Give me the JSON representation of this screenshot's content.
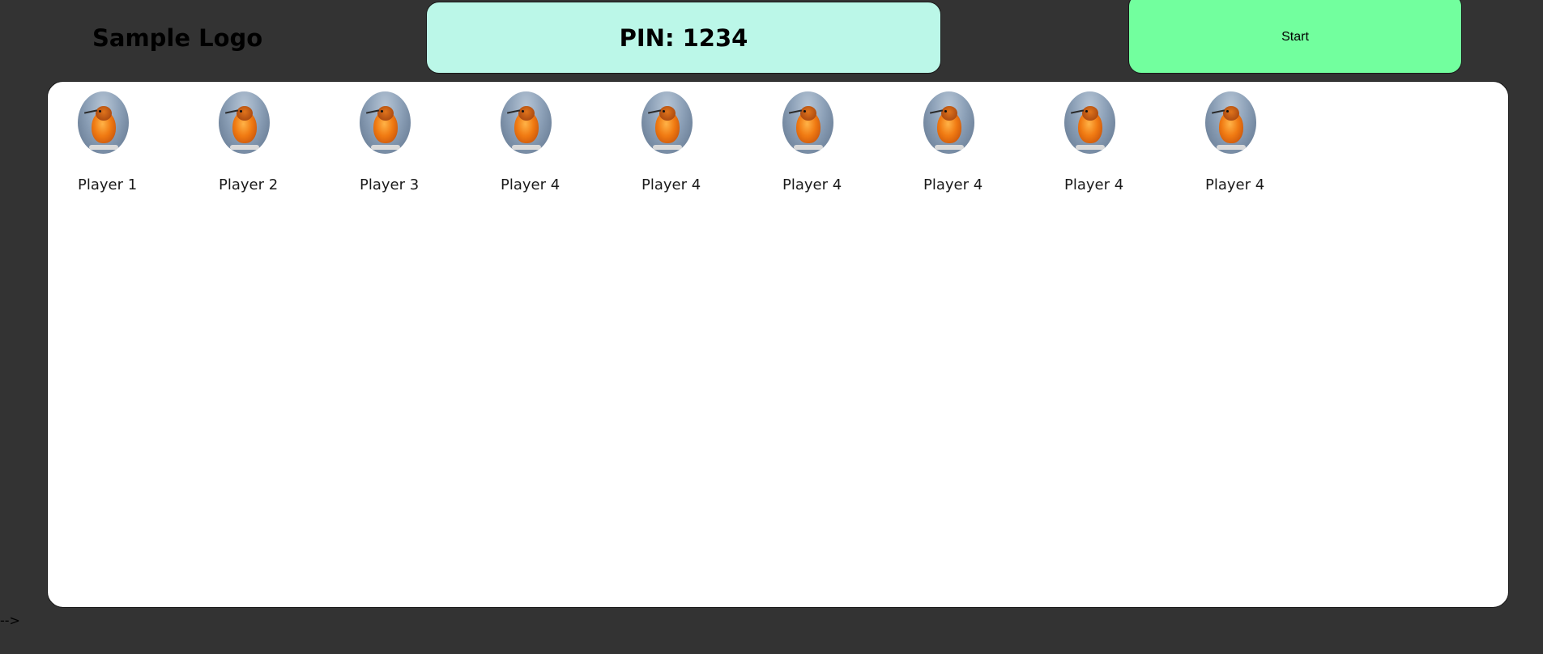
{
  "header": {
    "logo_text": "Sample Logo",
    "pin_text": "PIN: 1234",
    "start_label": "Start"
  },
  "players": [
    {
      "name": "Player 1",
      "avatar": "bird-avatar"
    },
    {
      "name": "Player 2",
      "avatar": "bird-avatar"
    },
    {
      "name": "Player 3",
      "avatar": "bird-avatar"
    },
    {
      "name": "Player 4",
      "avatar": "bird-avatar"
    },
    {
      "name": "Player 4",
      "avatar": "bird-avatar"
    },
    {
      "name": "Player 4",
      "avatar": "bird-avatar"
    },
    {
      "name": "Player 4",
      "avatar": "bird-avatar"
    },
    {
      "name": "Player 4",
      "avatar": "bird-avatar"
    },
    {
      "name": "Player 4",
      "avatar": "bird-avatar"
    }
  ],
  "footer": {
    "stray_text": "-->"
  },
  "colors": {
    "background": "#333333",
    "pin_box": "#bbf7e8",
    "start_button": "#72ff9e",
    "panel": "#ffffff"
  }
}
